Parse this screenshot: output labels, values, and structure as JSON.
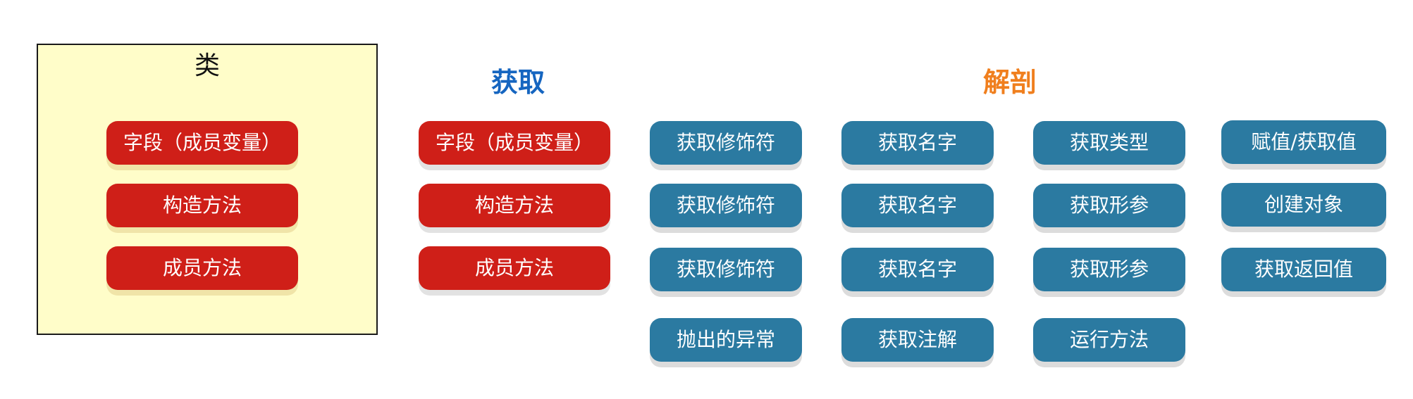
{
  "class_box": {
    "title": "类",
    "items": [
      "字段（成员变量）",
      "构造方法",
      "成员方法"
    ]
  },
  "get_section": {
    "title": "获取",
    "items": [
      "字段（成员变量）",
      "构造方法",
      "成员方法"
    ]
  },
  "dissect_section": {
    "title": "解剖",
    "columns": [
      [
        "获取修饰符",
        "获取修饰符",
        "获取修饰符",
        "抛出的异常"
      ],
      [
        "获取名字",
        "获取名字",
        "获取名字",
        "获取注解"
      ],
      [
        "获取类型",
        "获取形参",
        "获取形参",
        "运行方法"
      ],
      [
        "赋值/获取值",
        "创建对象",
        "获取返回值"
      ]
    ]
  },
  "colors": {
    "class_box_fill": "#fffdc9",
    "red_button": "#cf1f18",
    "blue_button": "#2b7aa1",
    "get_title": "#1565c0",
    "dissect_title": "#f07f1e"
  }
}
